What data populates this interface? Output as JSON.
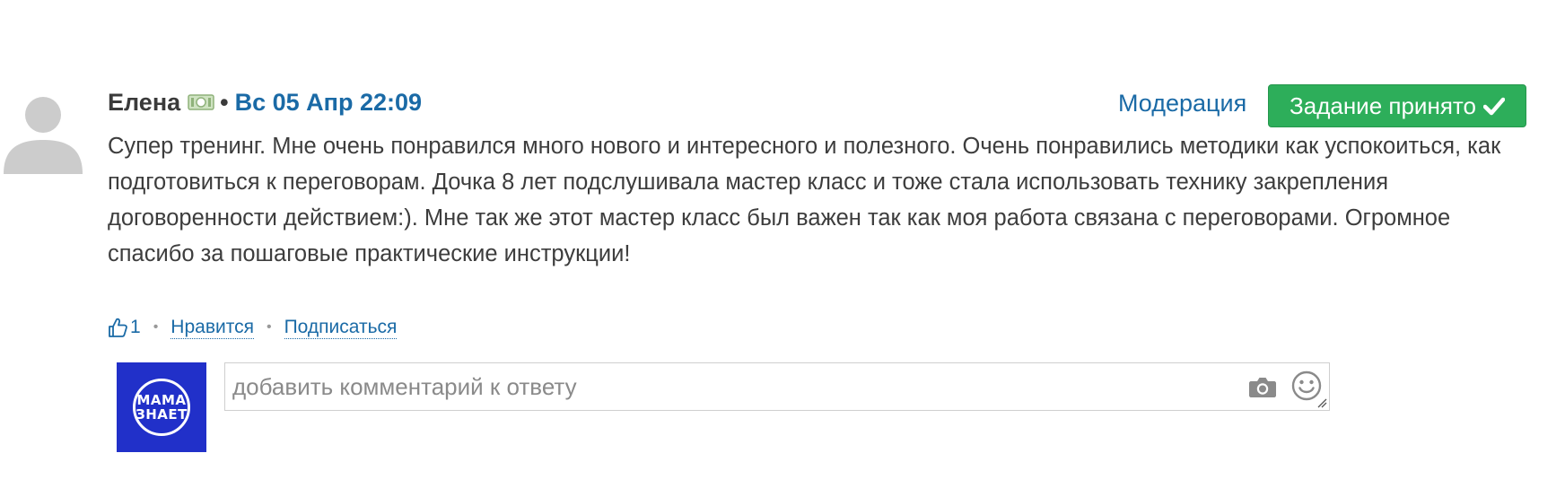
{
  "comment": {
    "author": "Елена",
    "separator": "•",
    "date": "Вс 05 Апр 22:09",
    "text": "Супер тренинг. Мне очень понравился много нового и интересного и полезного. Очень понравились методики как успокоиться, как подготовиться к переговорам. Дочка 8 лет подслушивала мастер класс и тоже стала использовать технику закрепления договоренности действием:). Мне так же этот мастер класс был важен так как моя работа связана с переговорами. Огромное спасибо за пошаговые практические инструкции!"
  },
  "header_actions": {
    "moderation_label": "Модерация",
    "accepted_label": "Задание принято",
    "accepted_color": "#2dae5a"
  },
  "actions": {
    "like_icon": "thumbs-up-icon",
    "like_count": "1",
    "separator": "•",
    "like_label": "Нравится",
    "subscribe_label": "Подписаться"
  },
  "reply": {
    "logo_text_line1": "МАМА",
    "logo_text_line2": "ЗНАЕТ",
    "logo_bg": "#2130c9",
    "placeholder": "добавить комментарий к ответу",
    "value": "",
    "camera_icon": "camera-icon",
    "smile_icon": "smile-icon"
  },
  "colors": {
    "link": "#1a6aa6",
    "text": "#3d3d3d"
  }
}
